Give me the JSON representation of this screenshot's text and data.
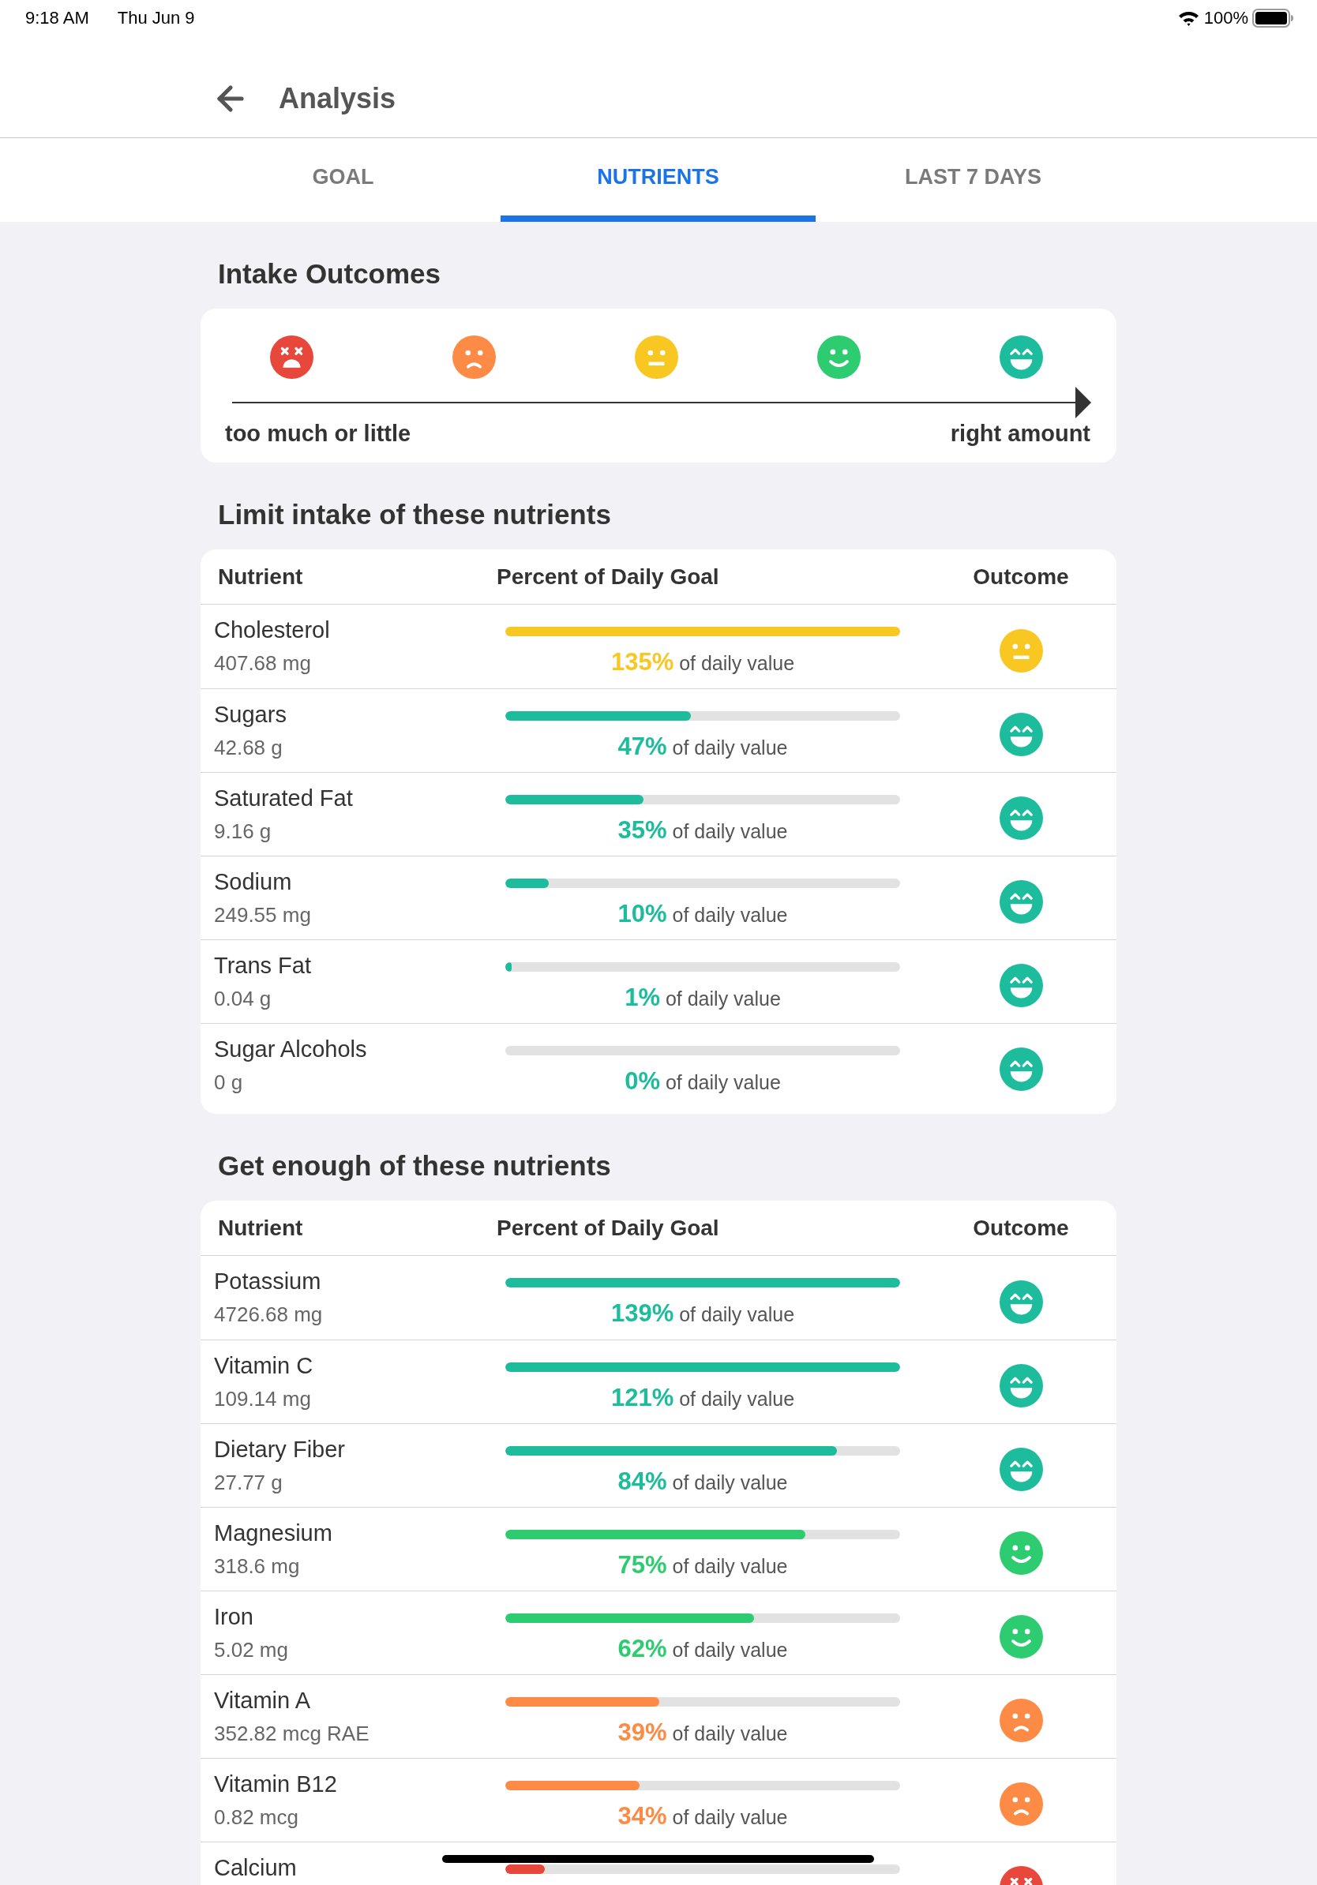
{
  "status_bar": {
    "time": "9:18 AM",
    "date": "Thu Jun 9",
    "battery": "100%"
  },
  "header": {
    "title": "Analysis"
  },
  "tabs": [
    {
      "label": "GOAL",
      "selected": false
    },
    {
      "label": "NUTRIENTS",
      "selected": true
    },
    {
      "label": "LAST 7 DAYS",
      "selected": false
    }
  ],
  "intake_outcomes": {
    "title": "Intake Outcomes",
    "scale": [
      {
        "kind": "worst"
      },
      {
        "kind": "poor"
      },
      {
        "kind": "fair"
      },
      {
        "kind": "good"
      },
      {
        "kind": "best"
      }
    ],
    "left_label": "too much or little",
    "right_label": "right amount"
  },
  "sections": [
    {
      "title": "Limit intake of these nutrients",
      "columns": [
        "Nutrient",
        "Percent of Daily Goal",
        "Outcome"
      ],
      "rows": [
        {
          "name": "Cholesterol",
          "amount": "407.68 mg",
          "level": 1,
          "percent": "**135%** of daily value",
          "kind": "fair"
        },
        {
          "name": "Sugars",
          "amount": "42.68 g",
          "level": 0.47,
          "percent": "**47%** of daily value",
          "kind": "best"
        },
        {
          "name": "Saturated Fat",
          "amount": "9.16 g",
          "level": 0.35,
          "percent": "**35%** of daily value",
          "kind": "best"
        },
        {
          "name": "Sodium",
          "amount": "249.55 mg",
          "level": 0.11,
          "percent": "**10%** of daily value",
          "kind": "best"
        },
        {
          "name": "Trans Fat",
          "amount": "0.04 g",
          "level": 0.015,
          "percent": "**1%** of daily value",
          "kind": "best"
        },
        {
          "name": "Sugar Alcohols",
          "amount": "0 g",
          "level": 0,
          "percent": "**0%** of daily value",
          "kind": "best"
        }
      ]
    },
    {
      "title": "Get enough of these nutrients",
      "columns": [
        "Nutrient",
        "Percent of Daily Goal",
        "Outcome"
      ],
      "rows": [
        {
          "name": "Potassium",
          "amount": "4726.68 mg",
          "level": 1,
          "percent": "**139%** of daily value",
          "kind": "best"
        },
        {
          "name": "Vitamin C",
          "amount": "109.14 mg",
          "level": 1,
          "percent": "**121%** of daily value",
          "kind": "best"
        },
        {
          "name": "Dietary Fiber",
          "amount": "27.77 g",
          "level": 0.84,
          "percent": "**84%** of daily value",
          "kind": "best"
        },
        {
          "name": "Magnesium",
          "amount": "318.6 mg",
          "level": 0.76,
          "percent": "**75%** of daily value",
          "kind": "good"
        },
        {
          "name": "Iron",
          "amount": "5.02 mg",
          "level": 0.63,
          "percent": "**62%** of daily value",
          "kind": "good"
        },
        {
          "name": "Vitamin A",
          "amount": "352.82 mcg RAE",
          "level": 0.39,
          "percent": "**39%** of daily value",
          "kind": "poor"
        },
        {
          "name": "Vitamin B12",
          "amount": "0.82 mcg",
          "level": 0.34,
          "percent": "**34%** of daily value",
          "kind": "poor"
        },
        {
          "name": "Calcium",
          "level": 0.1,
          "kind": "worst"
        }
      ]
    }
  ]
}
